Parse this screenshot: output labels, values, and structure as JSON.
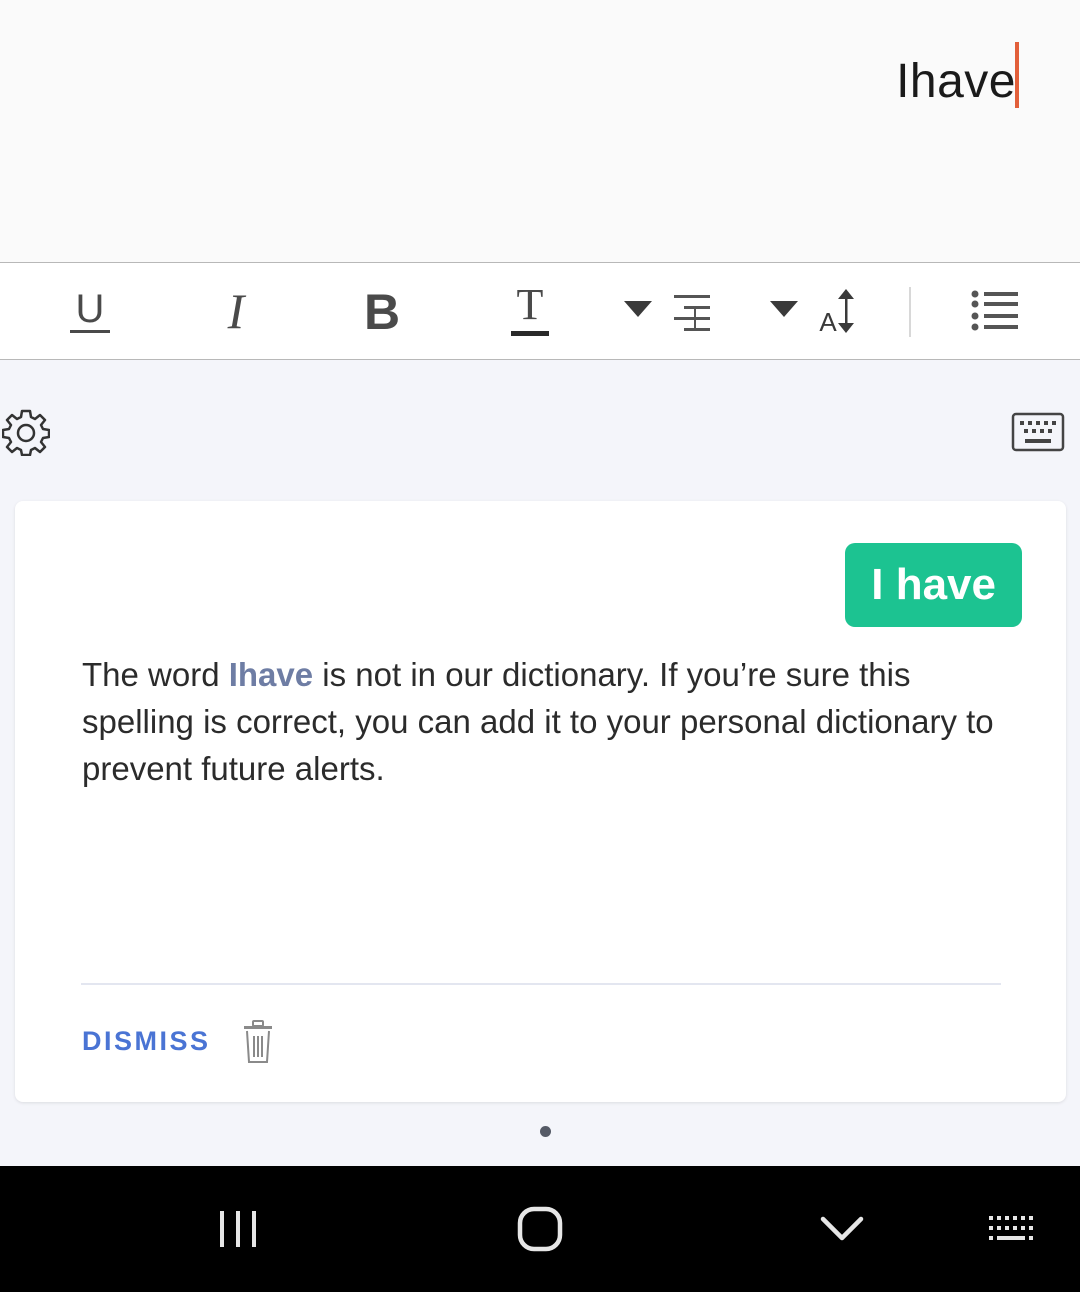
{
  "editor": {
    "text": "Ihave"
  },
  "toolbar": {
    "underline_label": "U",
    "italic_label": "I",
    "bold_label": "B",
    "text_style_label": "T",
    "font_size_label": "A"
  },
  "card": {
    "suggestion": "I have",
    "message_before": "The word ",
    "message_word": "Ihave",
    "message_after": " is not in our dictionary. If you’re sure this spelling is correct, you can add it to your personal dictionary to prevent future alerts.",
    "dismiss_label": "DISMISS"
  },
  "colors": {
    "caret": "#e25f3a",
    "suggestion_bg": "#1cc391",
    "dismiss": "#4a74d4",
    "word_highlight": "#6e7da4"
  },
  "icons": {
    "settings": "gear-icon",
    "keyboard": "keyboard-icon",
    "trash": "trash-icon",
    "align": "align-right-icon",
    "list": "bulleted-list-icon",
    "nav_recents": "recent-apps-icon",
    "nav_home": "home-icon",
    "nav_back": "back-chevron-icon",
    "nav_keyboard": "keyboard-dots-icon"
  }
}
